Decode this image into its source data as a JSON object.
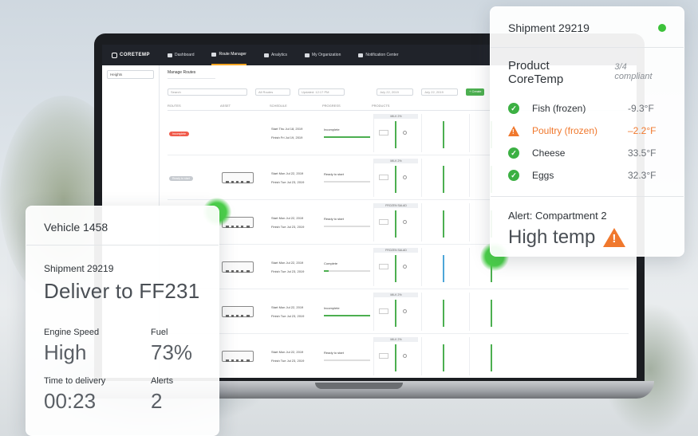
{
  "app": {
    "logo": "CORETEMP",
    "nav": [
      "Dashboard",
      "Route Manager",
      "Analytics",
      "My Organization",
      "Notification Center"
    ],
    "active_nav": "Route Manager",
    "side_select": "Heights",
    "tab": "Manage Routes",
    "search_placeholder": "Search",
    "filter": "All Routes",
    "updated": "Updated: 12:17 PM",
    "date_from": "July 22, 2019",
    "date_to": "July 22, 2019",
    "create_button": "+ Create",
    "columns": [
      "ROUTES",
      "ASSET",
      "SCHEDULE",
      "PROGRESS",
      "PRODUCTS"
    ],
    "rows": [
      {
        "progress_label": "Incomplete",
        "badge": "Incomplete",
        "start": "Thu Jul 18, 2019",
        "finish": "Fri Jul 19, 2019",
        "progress": 1.0,
        "sku": "MILK 2%"
      },
      {
        "progress_label": "Ready to start",
        "badge": "Ready to start",
        "start": "Mon Jul 22, 2019",
        "finish": "Tue Jul 23, 2019",
        "progress": 0.0,
        "sku": "MILK 2%"
      },
      {
        "progress_label": "Ready to start",
        "badge": "",
        "start": "Mon Jul 22, 2019",
        "finish": "Tue Jul 23, 2019",
        "progress": 0.0,
        "sku": "FROZEN SALAD"
      },
      {
        "progress_label": "Complete",
        "badge": "",
        "start": "Mon Jul 22, 2019",
        "finish": "Tue Jul 23, 2019",
        "progress": 0.1,
        "sku": "FROZEN SALAD"
      },
      {
        "progress_label": "Incomplete",
        "badge": "",
        "start": "Mon Jul 22, 2019",
        "finish": "Tue Jul 23, 2019",
        "progress": 1.0,
        "sku": "MILK 2%"
      },
      {
        "progress_label": "Ready to start",
        "badge": "",
        "start": "Mon Jul 22, 2019",
        "finish": "Tue Jul 23, 2019",
        "progress": 0.0,
        "sku": "MILK 2%"
      }
    ],
    "sched_start": "Start",
    "sched_finish": "Finish"
  },
  "vehicle_card": {
    "title": "Vehicle 1458",
    "shipment_label": "Shipment 29219",
    "deliver": "Deliver to FF231",
    "engine_label": "Engine Speed",
    "engine_value": "High",
    "fuel_label": "Fuel",
    "fuel_value": "73%",
    "time_label": "Time to delivery",
    "time_value": "00:23",
    "alerts_label": "Alerts",
    "alerts_value": "2"
  },
  "shipment_card": {
    "title": "Shipment 29219",
    "status_color": "#3cc23a",
    "product": "Product CoreTemp",
    "compliance": "3/4 compliant",
    "items": [
      {
        "name": "Fish (frozen)",
        "value": "-9.3°F",
        "status": "ok"
      },
      {
        "name": "Poultry (frozen)",
        "value": "‒2.2°F",
        "status": "warn"
      },
      {
        "name": "Cheese",
        "value": "33.5°F",
        "status": "ok"
      },
      {
        "name": "Eggs",
        "value": "32.3°F",
        "status": "ok"
      }
    ],
    "alert_label": "Alert: Compartment 2",
    "alert_value": "High temp",
    "warn_color": "#f0782d"
  }
}
